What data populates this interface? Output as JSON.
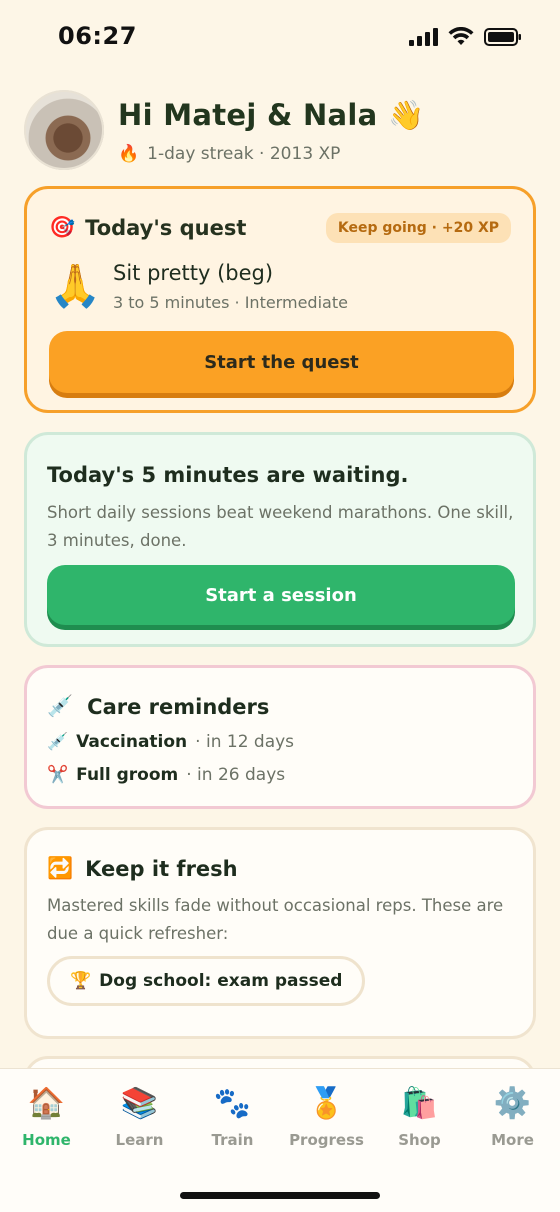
{
  "status": {
    "time": "06:27"
  },
  "header": {
    "greeting": "Hi Matej & Nala",
    "wave": "👋",
    "streak_icon": "🔥",
    "streak": "1-day streak · 2013 XP"
  },
  "quest": {
    "icon": "🎯",
    "title": "Today's quest",
    "badge": "Keep going · +20 XP",
    "skill_icon": "🙏",
    "skill": "Sit pretty (beg)",
    "meta": "3 to 5 minutes · Intermediate",
    "button": "Start the quest"
  },
  "session": {
    "title": "Today's 5 minutes are waiting.",
    "text": "Short daily sessions beat weekend marathons. One skill, 3 minutes, done.",
    "button": "Start a session"
  },
  "care": {
    "icon": "💉",
    "title": "Care reminders",
    "items": [
      {
        "icon": "💉",
        "name": "Vaccination",
        "when": "· in 12 days"
      },
      {
        "icon": "✂️",
        "name": "Full groom",
        "when": "· in 26 days"
      }
    ]
  },
  "fresh": {
    "icon": "🔁",
    "title": "Keep it fresh",
    "text": "Mastered skills fade without occasional reps. These are due a quick refresher:",
    "pill_icon": "🏆",
    "pill": "Dog school: exam passed"
  },
  "tabs": [
    {
      "icon": "🏠",
      "label": "Home",
      "active": true
    },
    {
      "icon": "📚",
      "label": "Learn",
      "active": false
    },
    {
      "icon": "🐾",
      "label": "Train",
      "active": false
    },
    {
      "icon": "🏅",
      "label": "Progress",
      "active": false
    },
    {
      "icon": "🛍️",
      "label": "Shop",
      "active": false
    },
    {
      "icon": "⚙️",
      "label": "More",
      "active": false
    }
  ],
  "colors": {
    "background": "#fdf6e7",
    "accent_orange": "#fba124",
    "accent_green": "#2fb56b",
    "quest_border": "#f6a02a",
    "care_border": "#f2c9d3"
  }
}
